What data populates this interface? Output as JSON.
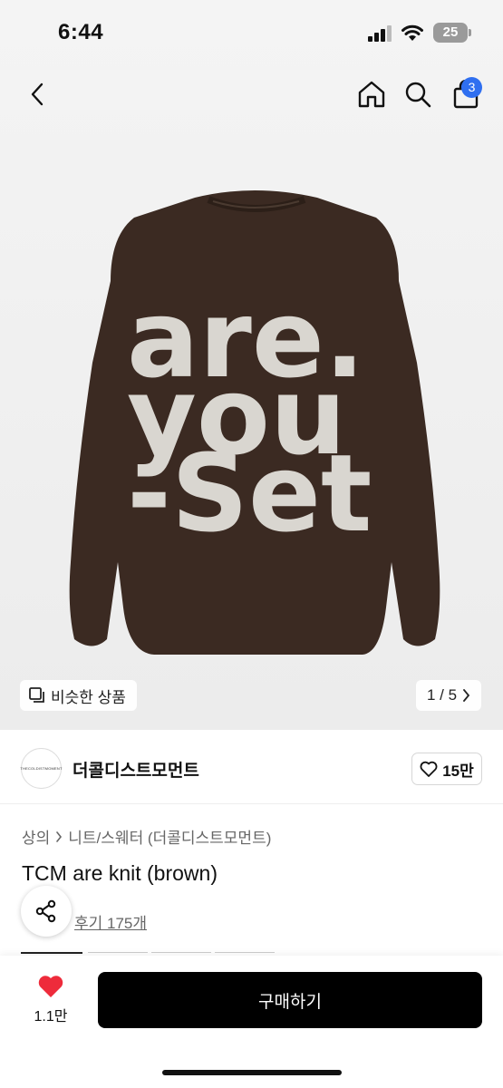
{
  "status_bar": {
    "time": "6:44",
    "battery": "25"
  },
  "nav": {
    "back_icon": "chevron-left-icon",
    "home_icon": "home-icon",
    "search_icon": "search-icon",
    "cart_icon": "shopping-bag-icon",
    "cart_count": "3"
  },
  "product_image": {
    "sweater_text": [
      "are.",
      "you",
      "-Set"
    ],
    "sweater_color": "#3b2a22",
    "text_color": "#d9d6d0"
  },
  "image_overlay": {
    "similar_label": "비슷한 상품",
    "pager": "1 / 5"
  },
  "brand": {
    "logo_text": "THECOLDISTMOMENT",
    "name": "더콜디스트모먼트",
    "like_count": "15만"
  },
  "breadcrumb": {
    "category": "상의",
    "subcategory": "니트/스웨터 (더콜디스트모먼트)"
  },
  "product": {
    "title": "TCM are knit (brown)",
    "reviews": "후기 175개"
  },
  "bottom": {
    "wish_count": "1.1만",
    "buy_label": "구매하기",
    "heart_color": "#ee2b3b"
  }
}
